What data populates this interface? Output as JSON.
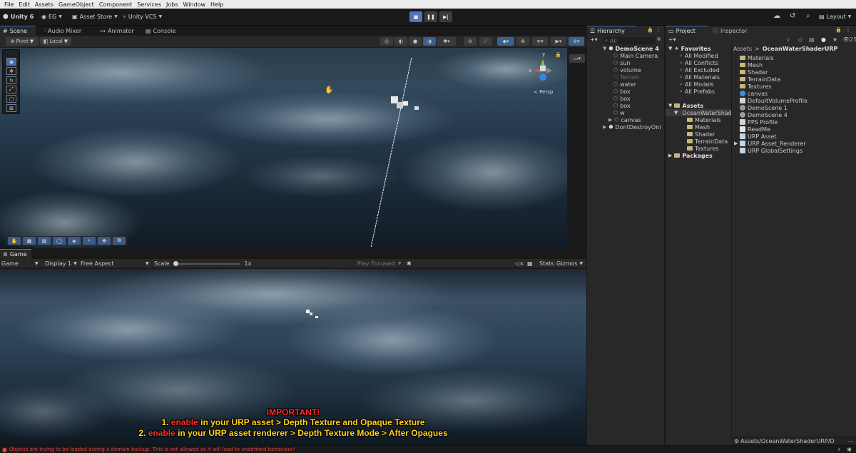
{
  "menu": [
    "File",
    "Edit",
    "Assets",
    "GameObject",
    "Component",
    "Services",
    "Jobs",
    "Window",
    "Help"
  ],
  "toolbar": {
    "unity_label": "Unity 6",
    "account": "EG",
    "asset_store": "Asset Store",
    "vcs": "Unity VCS",
    "layout": "Layout"
  },
  "scene_tabs": [
    "Scene",
    "Audio Mixer",
    "Animator",
    "Console"
  ],
  "scene_toolbar": {
    "pivot": "Pivot",
    "local": "Local"
  },
  "gizmo": {
    "axis_y": "y",
    "axis_x": "x",
    "persp": "< Persp"
  },
  "game": {
    "tab": "Game",
    "mode": "Game",
    "display": "Display 1",
    "aspect": "Free Aspect",
    "scale_label": "Scale",
    "scale_value": "1x",
    "play_focused": "Play Focused",
    "stats": "Stats",
    "gizmos": "Gizmos"
  },
  "overlay_text": {
    "important": "IMPORTANT!",
    "line1_prefix": "1. ",
    "line1_enable": "enable",
    "line1_rest": " in your URP asset > Depth Texture and Opaque Texture",
    "line2_prefix": "2. ",
    "line2_enable": "enable",
    "line2_rest": " in your URP asset renderer > Depth Texture Mode > After Opagues"
  },
  "hierarchy": {
    "tab": "Hierarchy",
    "search_placeholder": "All",
    "scene": "DemoScene 4",
    "items": [
      "Main Camera",
      "sun",
      "volume",
      "Terrain",
      "water",
      "box",
      "box",
      "box",
      "w",
      "canvas"
    ],
    "dont_destroy": "DontDestroyOnl"
  },
  "project": {
    "tab": "Project",
    "inspector_tab": "Inspector",
    "count": "25",
    "favorites": {
      "label": "Favorites",
      "items": [
        "All Modified",
        "All Conflicts",
        "All Excluded",
        "All Materials",
        "All Models",
        "All Prefabs"
      ]
    },
    "assets": {
      "label": "Assets",
      "ocean": "OceanWaterShad",
      "children": [
        "Materials",
        "Mesh",
        "Shader",
        "TerrainData",
        "Textures"
      ]
    },
    "packages": "Packages",
    "breadcrumb_root": "Assets",
    "breadcrumb_sep": ">",
    "breadcrumb_folder": "OceanWaterShaderURP",
    "contents": [
      "Materials",
      "Mesh",
      "Shader",
      "TerrainData",
      "Textures",
      "canvas",
      "DefaultVolumeProfile",
      "DemoScene 1",
      "DemoScene 4",
      "PPS Profile",
      "ReadMe",
      "URP Asset",
      "URP Asset_Renderer",
      "URP GlobalSettings"
    ],
    "path": "Assets/OceanWaterShaderURP/D"
  },
  "status": {
    "message": "Objects are trying to be loaded during a domain backup. This is not allowed as it will lead to undefined behaviour!"
  },
  "colors": {
    "accent": "#3a79d9",
    "warning_red": "#ff2a2a",
    "warning_yellow": "#ffd21a",
    "status_error": "#e04646"
  }
}
